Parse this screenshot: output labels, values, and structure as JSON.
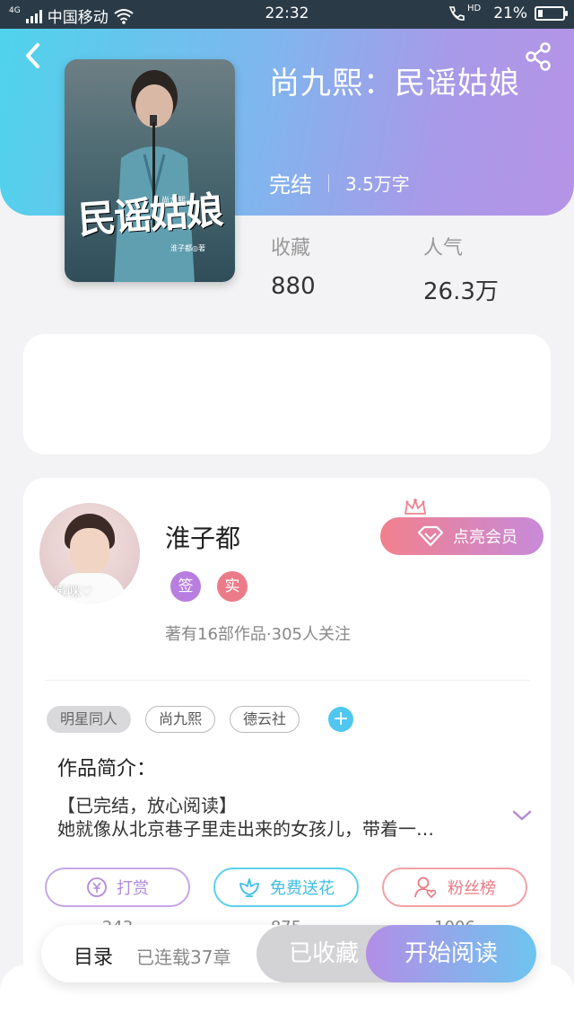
{
  "status_bar": {
    "network": "4G",
    "carrier": "中国移动",
    "time": "22:32",
    "hd": "HD",
    "battery": "21%",
    "battery_level": 0.21
  },
  "book": {
    "title": "尚九熙：民谣姑娘",
    "status": "完结",
    "word_count": "3.5万字",
    "cover": {
      "art_title": "民谣姑娘",
      "small_label": "尚九熙",
      "author_label": "淮子都◎著"
    },
    "stats": [
      {
        "label": "收藏",
        "value": "880"
      },
      {
        "label": "人气",
        "value": "26.3万"
      }
    ]
  },
  "author": {
    "name": "淮子都",
    "avatar_watermark": "啾咪♡",
    "badges": [
      "签",
      "实"
    ],
    "stats": "著有16部作品·305人关注",
    "vip_button": "点亮会员"
  },
  "tags": [
    "明星同人",
    "尚九熙",
    "德云社"
  ],
  "tag_add": "+",
  "intro": {
    "title": "作品简介：",
    "line1": "【已完结，放心阅读】",
    "line2": "她就像从北京巷子里走出来的女孩儿，带着一…"
  },
  "actions": [
    {
      "label": "打赏",
      "count": "243"
    },
    {
      "label": "免费送花",
      "count": "875"
    },
    {
      "label": "粉丝榜",
      "count": "1006"
    }
  ],
  "bottom_bar": {
    "toc": "目录",
    "serial": "已连载37章",
    "favorited": "已收藏",
    "start_reading": "开始阅读"
  },
  "colors": {
    "hero_start": "#4fd3ec",
    "hero_end": "#b693e6",
    "reward": "#b08ad9",
    "flower": "#3dbfe4",
    "fans": "#ea7a85"
  }
}
